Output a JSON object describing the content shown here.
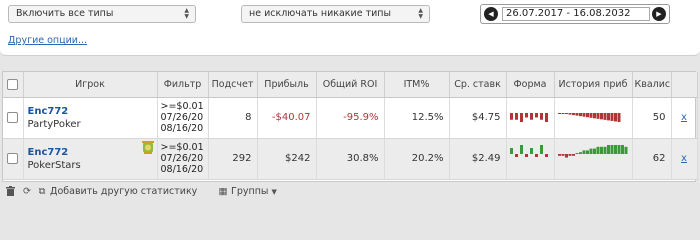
{
  "filters": {
    "type_select": "Включить все типы",
    "exclude_select": "не исключать никакие типы",
    "date_range": "26.07.2017 - 16.08.2032",
    "other_options": "Другие опции..."
  },
  "table": {
    "headers": [
      "Игрок",
      "Фильтр",
      "Подсчет",
      "Прибыль",
      "Общий ROI",
      "ITM%",
      "Ср. ставк",
      "Форма",
      "История приб",
      "Квалис"
    ],
    "rows": [
      {
        "player": "Enc772",
        "network": "PartyPoker",
        "filter_lines": [
          ">=$0.01",
          "07/26/20",
          "08/16/20"
        ],
        "count": "8",
        "profit": "-$40.07",
        "roi": "-95.9%",
        "itm": "12.5%",
        "avg_stake": "$4.75",
        "form": [
          -3,
          -3,
          -4,
          -2,
          -3,
          -2,
          -3,
          -4
        ],
        "history": [
          -1,
          -2,
          -2,
          -3,
          -4,
          -5,
          -6,
          -7,
          -8,
          -9,
          -10,
          -11,
          -12,
          -13,
          -14,
          -15,
          -16,
          -17
        ],
        "qualis": "50",
        "remove": "x"
      },
      {
        "player": "Enc772",
        "network": "PokerStars",
        "filter_lines": [
          ">=$0.01",
          "07/26/20",
          "08/16/20"
        ],
        "count": "292",
        "profit": "$242",
        "roi": "30.8%",
        "itm": "20.2%",
        "avg_stake": "$2.49",
        "form": [
          2,
          -1,
          3,
          -1,
          2,
          -1,
          3,
          -1
        ],
        "history": [
          -1,
          -1,
          -2,
          -1,
          -1,
          0,
          1,
          2,
          2,
          3,
          3,
          4,
          4,
          4,
          5,
          5,
          5,
          5,
          5,
          4
        ],
        "qualis": "62",
        "remove": "x"
      }
    ]
  },
  "footer": {
    "add_stats": "Добавить другую статистику",
    "groups": "Группы"
  },
  "colors": {
    "negative": "#b03636",
    "positive": "#3a9a3a",
    "link": "#2a67b5"
  }
}
